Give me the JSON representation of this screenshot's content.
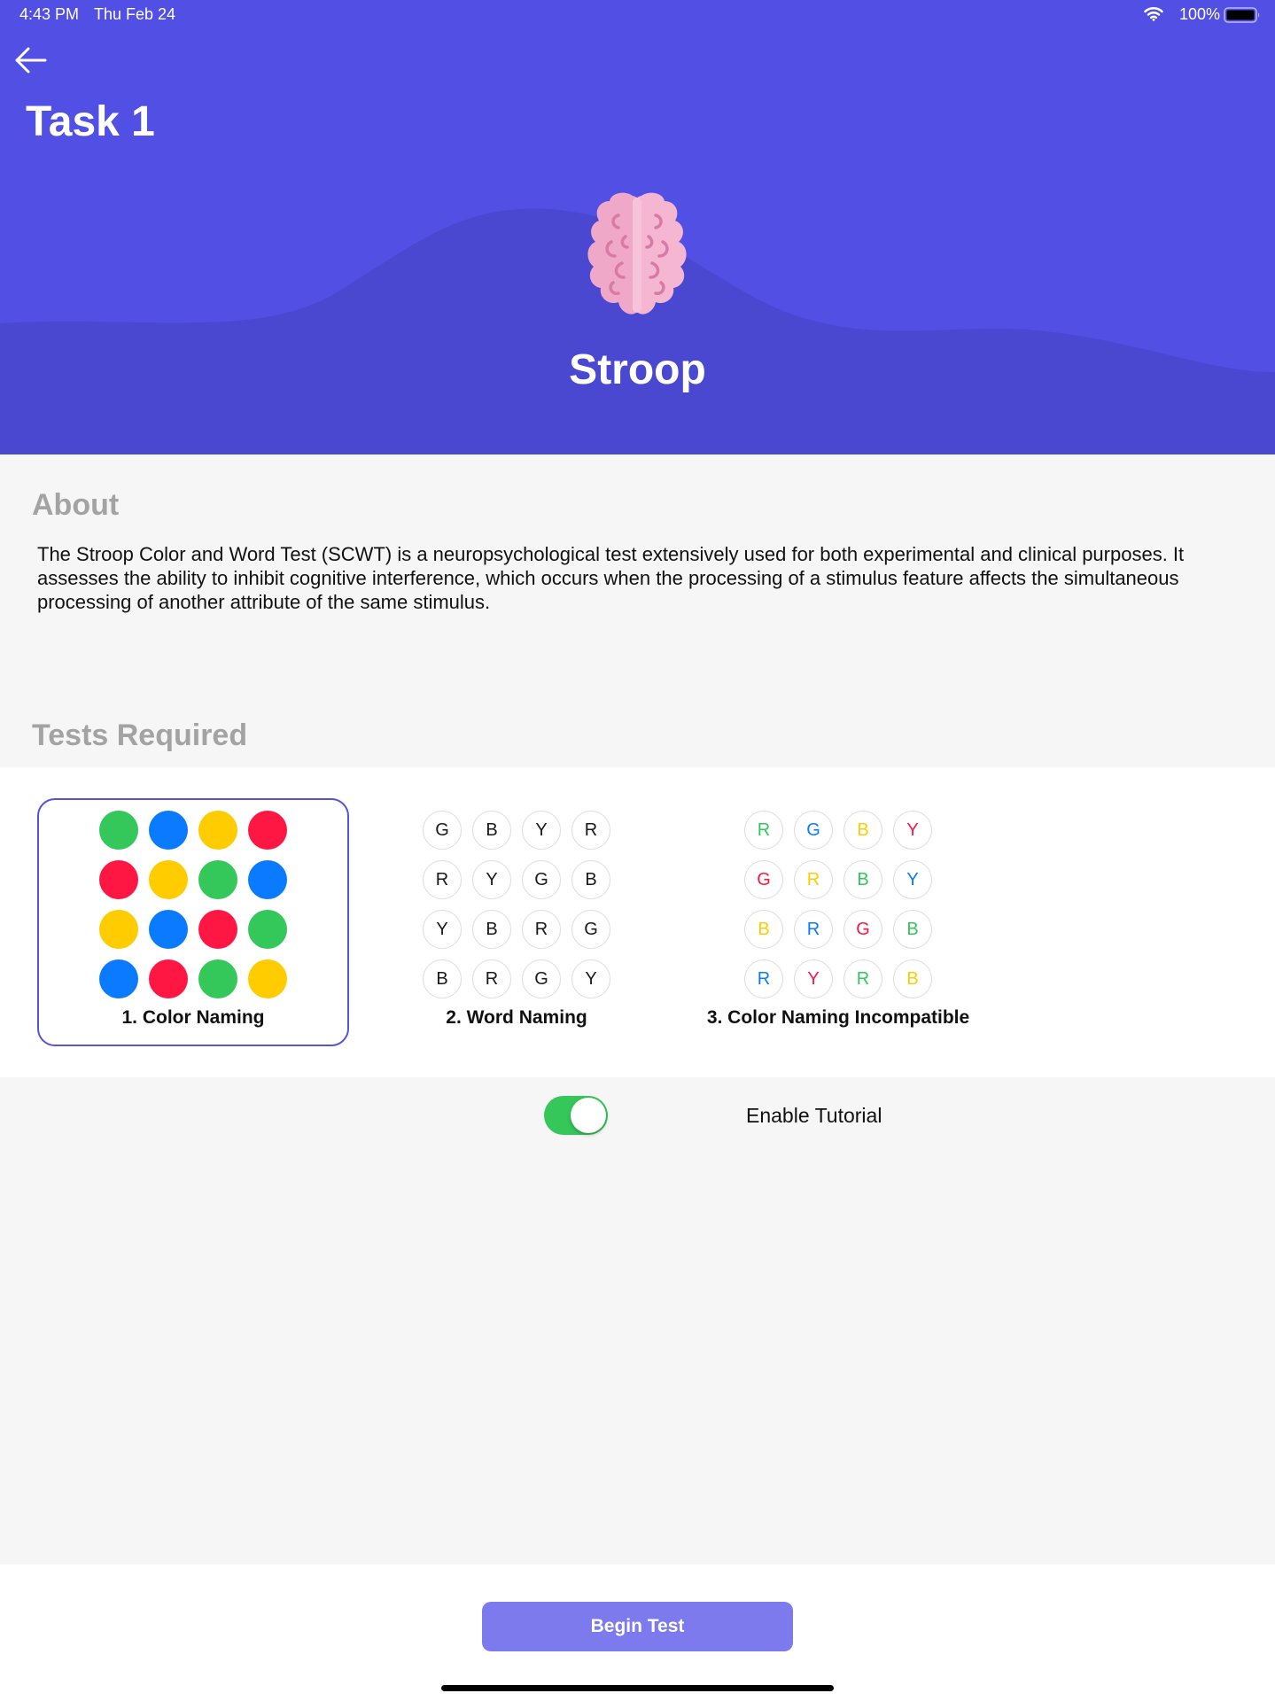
{
  "status_bar": {
    "time": "4:43 PM",
    "date": "Thu Feb 24",
    "battery": "100%"
  },
  "header": {
    "back_icon": "arrow-left-icon",
    "title": "Task 1",
    "illustration": "brain-icon",
    "test_name": "Stroop",
    "colors": {
      "background": "#524fe4",
      "wave": "#4a47d1"
    }
  },
  "about": {
    "heading": "About",
    "text": "The Stroop Color and Word Test (SCWT) is a neuropsychological test extensively used for both experimental and clinical purposes. It assesses the ability to inhibit cognitive interference, which occurs when the processing of a stimulus feature affects the simultaneous processing of another attribute of the same stimulus."
  },
  "tests": {
    "heading": "Tests Required",
    "palette": {
      "G": "#34c759",
      "B": "#0a7aff",
      "Y": "#ffcc00",
      "R": "#ff1744",
      "K": "#1a1a1a"
    },
    "items": [
      {
        "label": "1. Color Naming",
        "selected": true,
        "kind": "dots",
        "grid": [
          [
            "G",
            "B",
            "Y",
            "R"
          ],
          [
            "R",
            "Y",
            "G",
            "B"
          ],
          [
            "Y",
            "B",
            "R",
            "G"
          ],
          [
            "B",
            "R",
            "G",
            "Y"
          ]
        ]
      },
      {
        "label": "2. Word Naming",
        "selected": false,
        "kind": "letters",
        "grid": [
          [
            [
              "G",
              "K"
            ],
            [
              "B",
              "K"
            ],
            [
              "Y",
              "K"
            ],
            [
              "R",
              "K"
            ]
          ],
          [
            [
              "R",
              "K"
            ],
            [
              "Y",
              "K"
            ],
            [
              "G",
              "K"
            ],
            [
              "B",
              "K"
            ]
          ],
          [
            [
              "Y",
              "K"
            ],
            [
              "B",
              "K"
            ],
            [
              "R",
              "K"
            ],
            [
              "G",
              "K"
            ]
          ],
          [
            [
              "B",
              "K"
            ],
            [
              "R",
              "K"
            ],
            [
              "G",
              "K"
            ],
            [
              "Y",
              "K"
            ]
          ]
        ]
      },
      {
        "label": "3. Color Naming Incompatible",
        "selected": false,
        "kind": "letters",
        "grid": [
          [
            [
              "R",
              "G"
            ],
            [
              "G",
              "B"
            ],
            [
              "B",
              "Y"
            ],
            [
              "Y",
              "R"
            ]
          ],
          [
            [
              "G",
              "R"
            ],
            [
              "R",
              "Y"
            ],
            [
              "B",
              "G"
            ],
            [
              "Y",
              "B"
            ]
          ],
          [
            [
              "B",
              "Y"
            ],
            [
              "R",
              "B"
            ],
            [
              "G",
              "R"
            ],
            [
              "B",
              "G"
            ]
          ],
          [
            [
              "R",
              "B"
            ],
            [
              "Y",
              "R"
            ],
            [
              "R",
              "G"
            ],
            [
              "B",
              "Y"
            ]
          ]
        ]
      }
    ]
  },
  "tutorial": {
    "label": "Enable Tutorial",
    "enabled": true
  },
  "footer": {
    "begin_label": "Begin Test",
    "button_color": "#7d7aee"
  }
}
